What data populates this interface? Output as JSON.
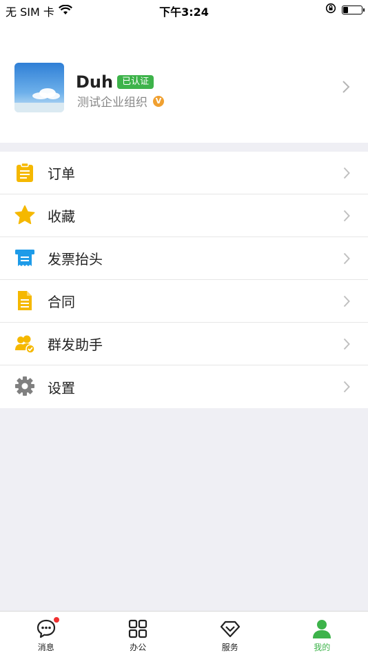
{
  "status_bar": {
    "carrier": "无 SIM 卡",
    "time": "下午3:24",
    "battery_level": 0.25
  },
  "profile": {
    "name": "Duh",
    "verified_badge": "已认证",
    "organization": "测试企业组织",
    "org_badge": "V"
  },
  "menu": {
    "items": [
      {
        "label": "订单",
        "icon": "clipboard-icon",
        "color": "#f5b800"
      },
      {
        "label": "收藏",
        "icon": "star-icon",
        "color": "#f5b800"
      },
      {
        "label": "发票抬头",
        "icon": "invoice-icon",
        "color": "#1e9be8"
      },
      {
        "label": "合同",
        "icon": "document-icon",
        "color": "#f5b800"
      },
      {
        "label": "群发助手",
        "icon": "group-users-icon",
        "color": "#f5b800"
      },
      {
        "label": "设置",
        "icon": "gear-icon",
        "color": "#808080"
      }
    ]
  },
  "tabbar": {
    "tabs": [
      {
        "label": "消息",
        "icon": "chat-bubble-icon",
        "has_notification": true
      },
      {
        "label": "办公",
        "icon": "grid-icon"
      },
      {
        "label": "服务",
        "icon": "diamond-icon"
      },
      {
        "label": "我的",
        "icon": "person-icon",
        "active": true
      }
    ],
    "active_color": "#3db34a"
  }
}
